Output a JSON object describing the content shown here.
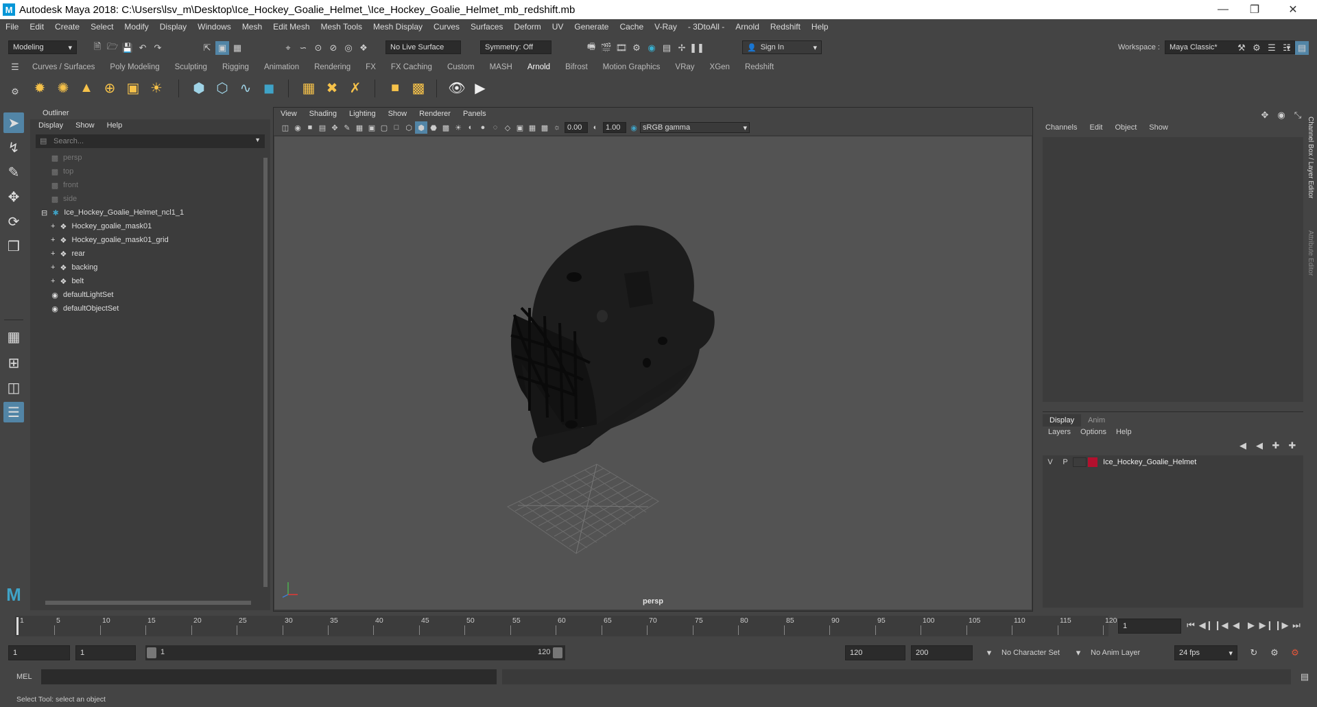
{
  "window": {
    "title": "Autodesk Maya 2018: C:\\Users\\lsv_m\\Desktop\\Ice_Hockey_Goalie_Helmet_\\Ice_Hockey_Goalie_Helmet_mb_redshift.mb",
    "logo": "M"
  },
  "menubar": [
    "File",
    "Edit",
    "Create",
    "Select",
    "Modify",
    "Display",
    "Windows",
    "Mesh",
    "Edit Mesh",
    "Mesh Tools",
    "Mesh Display",
    "Curves",
    "Surfaces",
    "Deform",
    "UV",
    "Generate",
    "Cache",
    "V-Ray",
    "- 3DtoAll -",
    "Arnold",
    "Redshift",
    "Help"
  ],
  "statusline": {
    "mode": "Modeling",
    "live_surface": "No Live Surface",
    "symmetry": "Symmetry: Off",
    "sign_in": "Sign In",
    "workspace_label": "Workspace :",
    "workspace_value": "Maya Classic*"
  },
  "shelf": {
    "tabs": [
      "Curves / Surfaces",
      "Poly Modeling",
      "Sculpting",
      "Rigging",
      "Animation",
      "Rendering",
      "FX",
      "FX Caching",
      "Custom",
      "MASH",
      "Arnold",
      "Bifrost",
      "Motion Graphics",
      "VRay",
      "XGen",
      "Redshift"
    ],
    "active_tab": "Arnold"
  },
  "outliner": {
    "title": "Outliner",
    "menu": [
      "Display",
      "Show",
      "Help"
    ],
    "search_placeholder": "Search...",
    "items": [
      {
        "label": "persp",
        "indent": 1,
        "icon": "camera",
        "dim": true
      },
      {
        "label": "top",
        "indent": 1,
        "icon": "camera",
        "dim": true
      },
      {
        "label": "front",
        "indent": 1,
        "icon": "camera",
        "dim": true
      },
      {
        "label": "side",
        "indent": 1,
        "icon": "camera",
        "dim": true
      },
      {
        "label": "Ice_Hockey_Goalie_Helmet_ncl1_1",
        "indent": 0,
        "icon": "group",
        "dim": false
      },
      {
        "label": "Hockey_goalie_mask01",
        "indent": 2,
        "icon": "mesh",
        "dim": false
      },
      {
        "label": "Hockey_goalie_mask01_grid",
        "indent": 2,
        "icon": "mesh",
        "dim": false
      },
      {
        "label": "rear",
        "indent": 2,
        "icon": "mesh",
        "dim": false
      },
      {
        "label": "backing",
        "indent": 2,
        "icon": "mesh",
        "dim": false
      },
      {
        "label": "belt",
        "indent": 2,
        "icon": "mesh",
        "dim": false
      },
      {
        "label": "defaultLightSet",
        "indent": 1,
        "icon": "set",
        "dim": false
      },
      {
        "label": "defaultObjectSet",
        "indent": 1,
        "icon": "set",
        "dim": false
      }
    ]
  },
  "viewport": {
    "menu": [
      "View",
      "Shading",
      "Lighting",
      "Show",
      "Renderer",
      "Panels"
    ],
    "exposure": "0.00",
    "gamma": "1.00",
    "color_space": "sRGB gamma",
    "camera_label": "persp"
  },
  "channelbox": {
    "menu": [
      "Channels",
      "Edit",
      "Object",
      "Show"
    ]
  },
  "layer_editor": {
    "tabs": [
      "Display",
      "Anim"
    ],
    "menu": [
      "Layers",
      "Options",
      "Help"
    ],
    "layer": {
      "v": "V",
      "p": "P",
      "name": "Ice_Hockey_Goalie_Helmet",
      "color": "#b3102e"
    }
  },
  "side_tabs": [
    "Channel Box / Layer Editor",
    "Attribute Editor"
  ],
  "timeline": {
    "ticks": [
      "1",
      "5",
      "10",
      "15",
      "20",
      "25",
      "30",
      "35",
      "40",
      "45",
      "50",
      "55",
      "60",
      "65",
      "70",
      "75",
      "80",
      "85",
      "90",
      "95",
      "100",
      "105",
      "110",
      "115",
      "120"
    ],
    "current_frame": "1"
  },
  "range": {
    "start": "1",
    "playback_start": "1",
    "slider_start": "1",
    "slider_end": "120",
    "playback_end": "120",
    "end": "200",
    "character_set": "No Character Set",
    "anim_layer": "No Anim Layer",
    "fps": "24 fps"
  },
  "command": {
    "label": "MEL"
  },
  "helpline": "Select Tool: select an object"
}
